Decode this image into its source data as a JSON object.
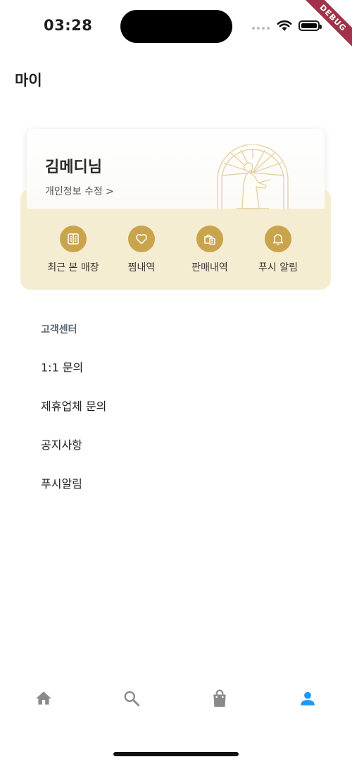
{
  "status_bar": {
    "time": "03:28",
    "debug_banner": "DEBUG"
  },
  "header": {
    "title": "마이"
  },
  "profile": {
    "name": "김메디님",
    "edit_link": "개인정보 수정 >"
  },
  "quick_actions": [
    {
      "label": "최근 본 매장",
      "icon": "recent-stores-icon"
    },
    {
      "label": "찜내역",
      "icon": "heart-icon"
    },
    {
      "label": "판매내역",
      "icon": "shopping-bag-receipt-icon"
    },
    {
      "label": "푸시 알림",
      "icon": "bell-icon"
    }
  ],
  "customer_center": {
    "section_label": "고객센터",
    "items": [
      "1:1 문의",
      "제휴업체 문의",
      "공지사항",
      "푸시알림"
    ]
  },
  "bottom_nav": {
    "items": [
      {
        "icon": "home-icon",
        "active": false
      },
      {
        "icon": "search-icon",
        "active": false
      },
      {
        "icon": "shopping-bag-icon",
        "active": false
      },
      {
        "icon": "person-icon",
        "active": true
      }
    ]
  },
  "colors": {
    "gold": "#c9a44d",
    "gold_light": "#f5edd2",
    "nav_active": "#2196f3",
    "nav_inactive": "#8a8a8a"
  }
}
